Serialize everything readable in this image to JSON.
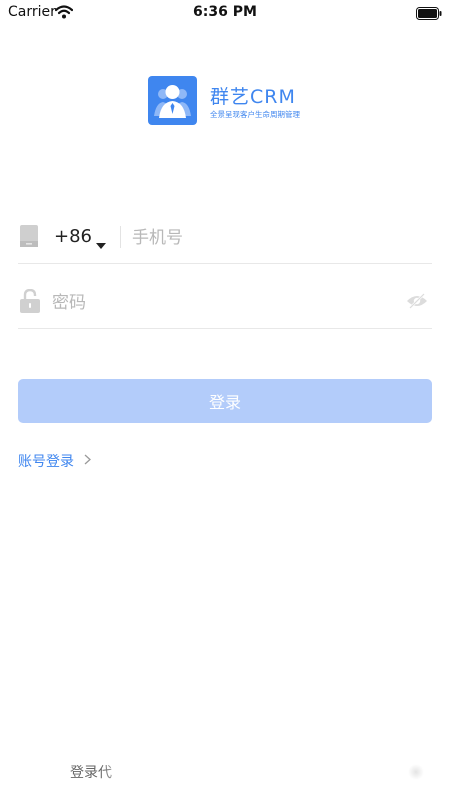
{
  "status_bar": {
    "carrier": "Carrier",
    "time": "6:36 PM",
    "wifi_icon": "wifi-icon",
    "battery_icon": "battery-icon"
  },
  "logo": {
    "title": "群艺CRM",
    "subtitle": "全景呈现客户生命周期管理",
    "icon": "user-avatar-icon",
    "color": "#3f86ef"
  },
  "form": {
    "phone": {
      "icon": "phone-icon",
      "country_code": "+86",
      "placeholder": "手机号",
      "value": ""
    },
    "password": {
      "icon": "lock-icon",
      "placeholder": "密码",
      "value": "",
      "visibility_icon": "eye-off-icon"
    },
    "login_button": "登录",
    "account_login_link": "账号登录"
  },
  "bottom": {
    "text": "登录代"
  },
  "colors": {
    "accent": "#3f86ef",
    "button_disabled": "#b3ccfa"
  }
}
